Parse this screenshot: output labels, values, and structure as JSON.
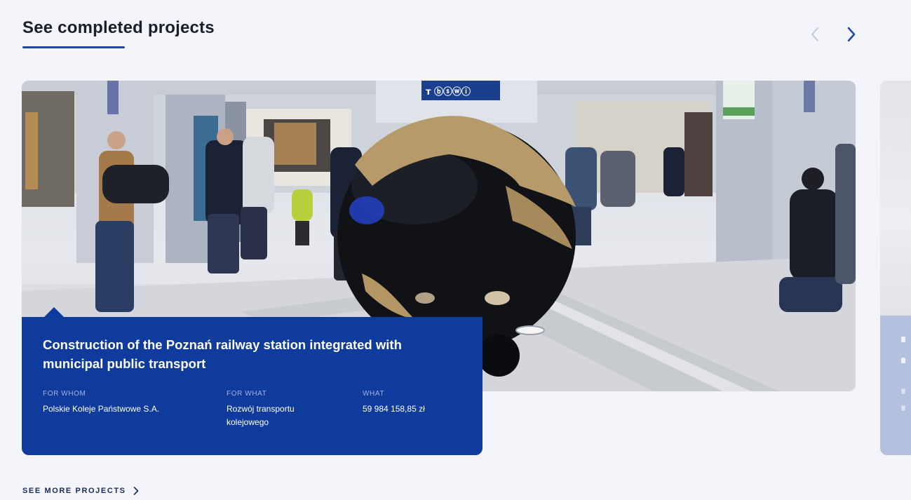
{
  "section": {
    "title": "See completed projects"
  },
  "carousel": {
    "prev_icon": "chevron-left-icon",
    "next_icon": "chevron-right-icon"
  },
  "project": {
    "title": "Construction of the Poznań railway station integrated with municipal public transport",
    "image_signage": "ᴛ ⓑⓢⓦⓘ",
    "for_whom_label": "FOR WHOM",
    "for_whom_value": "Polskie Koleje Państwowe S.A.",
    "for_what_label": "FOR WHAT",
    "for_what_value": "Rozwój transportu kolejowego",
    "what_label": "WHAT",
    "what_value": "59 984 158,85 zł"
  },
  "footer": {
    "more_label": "SEE MORE PROJECTS"
  },
  "colors": {
    "accent": "#1d47a8",
    "info_box": "#0f3b9c",
    "background": "#f3f5fa"
  }
}
